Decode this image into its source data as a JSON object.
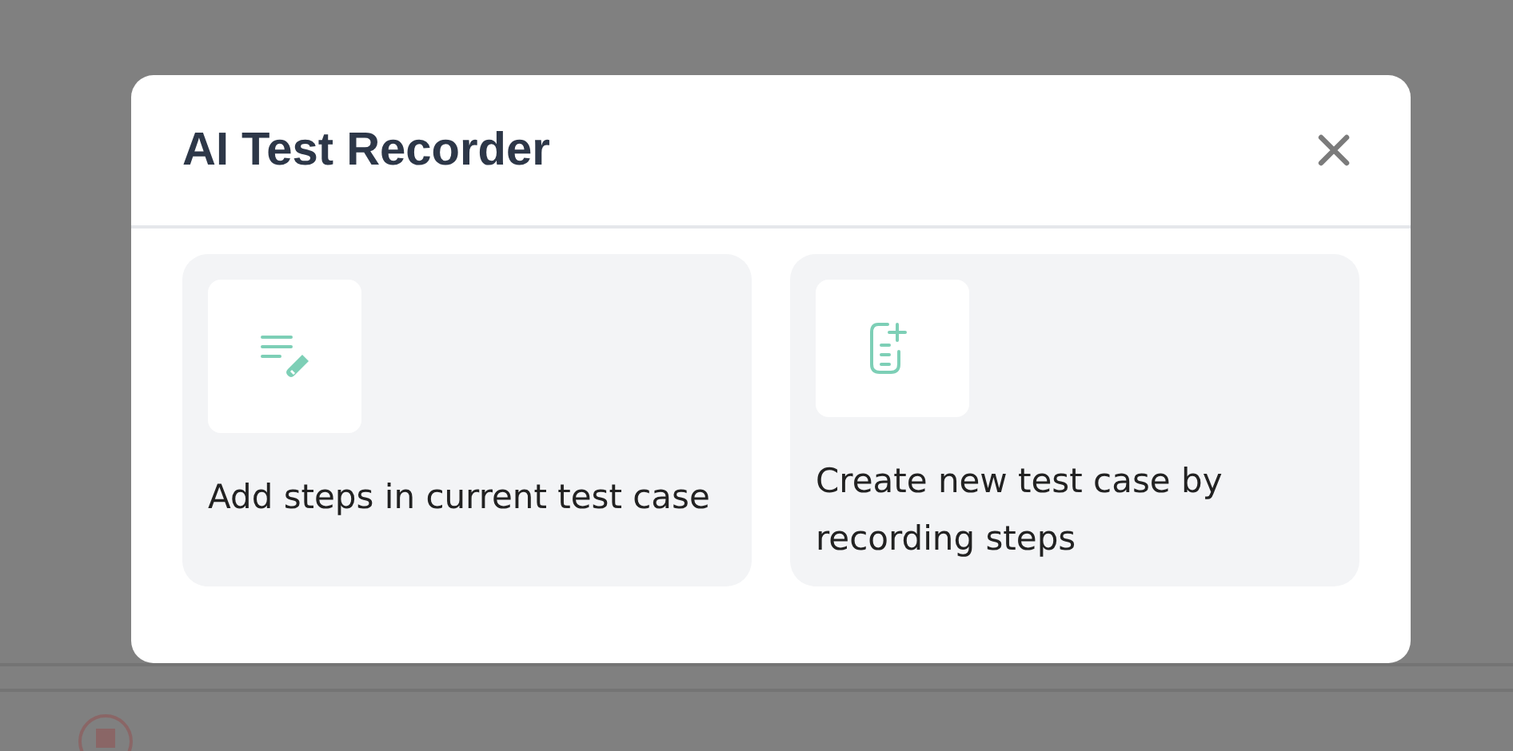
{
  "dialog": {
    "title": "AI Test Recorder",
    "options": [
      {
        "label": "Add steps in current test case",
        "kind": "edit"
      },
      {
        "label": "Create new test case by recording steps",
        "kind": "new"
      }
    ]
  }
}
